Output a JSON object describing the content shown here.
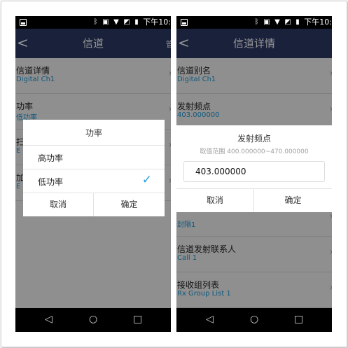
{
  "status_bar": {
    "time": "下午10:",
    "icons": [
      "bluetooth-icon",
      "nfc-icon",
      "wifi-icon",
      "no-sim-icon",
      "battery-icon"
    ]
  },
  "colors": {
    "header": "#2b3a66",
    "accent": "#1e9ad7",
    "check": "#2a9ee0"
  },
  "left_screen": {
    "header": {
      "back": "<",
      "title": "信道",
      "menu_label": "管"
    },
    "rows": [
      {
        "label": "信道详情",
        "value": "Digital Ch1"
      },
      {
        "label": "功率",
        "value": "低功率"
      },
      {
        "label": "扫",
        "value": "E"
      },
      {
        "label": "加",
        "value": "E"
      }
    ],
    "dialog": {
      "title": "功率",
      "options": [
        {
          "label": "高功率",
          "selected": false
        },
        {
          "label": "低功率",
          "selected": true,
          "check": "✓"
        }
      ],
      "cancel": "取消",
      "ok": "确定"
    }
  },
  "right_screen": {
    "header": {
      "back": "<",
      "title": "信道详情"
    },
    "rows": [
      {
        "label": "信道别名",
        "value": "Digital Ch1"
      },
      {
        "label": "发射频点",
        "value": "403.000000"
      },
      {
        "label": "",
        "value": ""
      },
      {
        "label": "",
        "value": ""
      },
      {
        "label": "",
        "value": "封隔1"
      },
      {
        "label": "信道发射联系人",
        "value": "Call 1"
      },
      {
        "label": "接收组列表",
        "value": "Rx Group List 1"
      }
    ],
    "dialog": {
      "title": "发射频点",
      "range": "取值范围 400.000000~470.000000",
      "input_value": "403.000000",
      "cancel": "取消",
      "ok": "确定"
    }
  },
  "navbar": {
    "back": "◁",
    "home": "○",
    "recents": "□"
  }
}
